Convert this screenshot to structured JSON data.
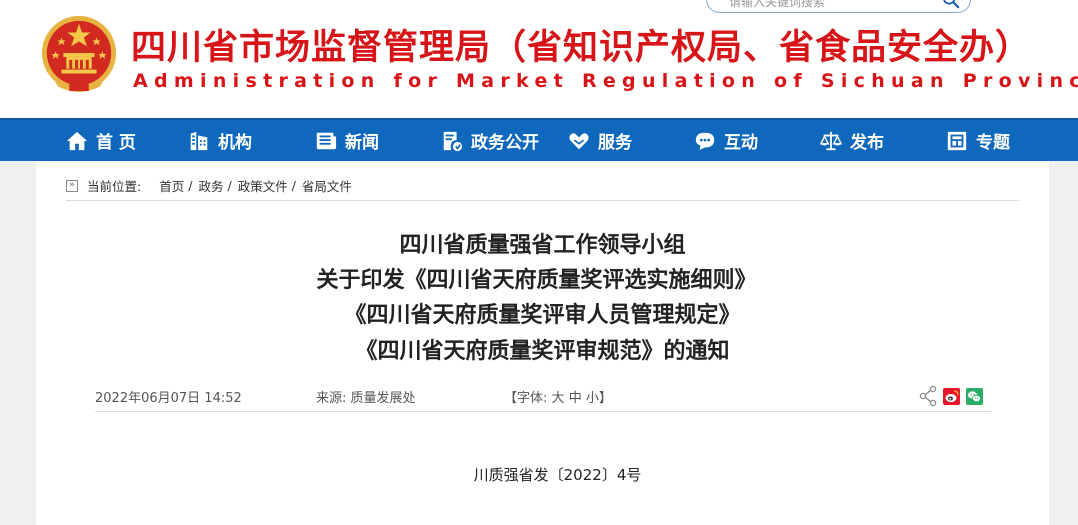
{
  "header": {
    "title": "四川省市场监督管理局（省知识产权局、省食品安全办）",
    "subtitle": "Administration for Market Regulation of Sichuan Province",
    "search_placeholder": "请输入关键词搜索",
    "title_color": "#d71418"
  },
  "nav": {
    "bg_color": "#1068bd",
    "items": [
      {
        "label": "首 页",
        "icon": "home-icon"
      },
      {
        "label": "机构",
        "icon": "building-icon"
      },
      {
        "label": "新闻",
        "icon": "news-icon"
      },
      {
        "label": "政务公开",
        "icon": "government-icon"
      },
      {
        "label": "服务",
        "icon": "service-icon"
      },
      {
        "label": "互动",
        "icon": "chat-icon"
      },
      {
        "label": "发布",
        "icon": "scales-icon"
      },
      {
        "label": "专题",
        "icon": "topic-icon"
      }
    ]
  },
  "breadcrumb": {
    "label": "当前位置:",
    "items": [
      "首页",
      "政务",
      "政策文件",
      "省局文件"
    ]
  },
  "article": {
    "title_lines": [
      "四川省质量强省工作领导小组",
      "关于印发《四川省天府质量奖评选实施细则》",
      "《四川省天府质量奖评审人员管理规定》",
      "《四川省天府质量奖评审规范》的通知"
    ],
    "date": "2022年06月07日 14:52",
    "source_label": "来源:",
    "source": "质量发展处",
    "font_label_open": "【字体:",
    "font_large": "大",
    "font_medium": "中",
    "font_small": "小",
    "font_label_close": "】",
    "doc_number": "川质强省发〔2022〕4号"
  }
}
